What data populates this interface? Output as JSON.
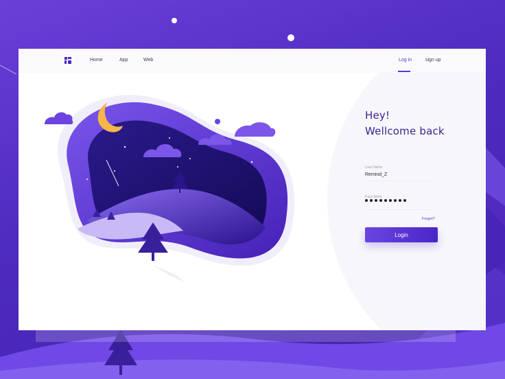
{
  "nav": {
    "links": [
      "Home",
      "App",
      "Web"
    ],
    "login_label": "Log in",
    "signup_label": "sign up"
  },
  "greeting": {
    "line1": "Hey!",
    "line2": "Wellcome back"
  },
  "form": {
    "username_label": "User Name",
    "username_value": "Remind_Z",
    "password_label": "Pass Word",
    "password_masked_length": 9,
    "forgot_label": "Forget?",
    "login_button": "Login"
  },
  "colors": {
    "accent": "#5a34d4",
    "background": "#5530c8",
    "card": "#ffffff",
    "title_text": "#3e2190"
  },
  "icons": {
    "logo": "app-logo-icon",
    "moon": "moon-icon"
  }
}
